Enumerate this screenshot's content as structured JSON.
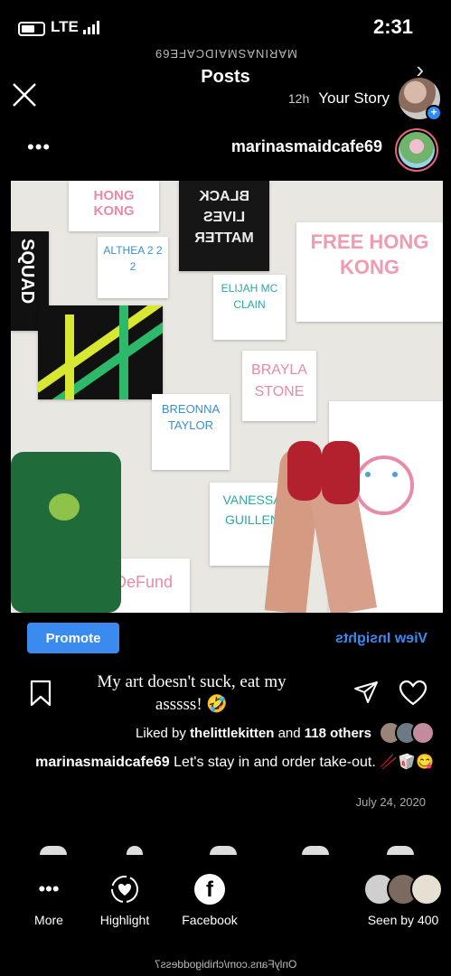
{
  "status": {
    "network": "LTE",
    "time": "2:31"
  },
  "header": {
    "account_overlay": "MARINASMAIDCAFE69",
    "title": "Posts"
  },
  "story": {
    "label": "Your Story",
    "time": "12h"
  },
  "post": {
    "username": "marinasmaidcafe69",
    "promote_label": "Promote",
    "insights_label": "View Insights",
    "caption_overlay": "My art doesn't suck, eat my asssss! 🤣",
    "liked_by_prefix": "Liked by",
    "liked_by_user": "thelittlekitten",
    "liked_by_and": "and",
    "liked_by_others": "118 others",
    "caption_user": "marinasmaidcafe69",
    "caption_text": "Let's stay in and order take-out. 🥢🥡😋",
    "date": "July 24, 2020"
  },
  "artwork": {
    "hong_kong_small": "HONG KONG",
    "blm": "BLACK LIVES MATTER",
    "squad": "SQUAD",
    "althea": "ALTHEA 2 2 2",
    "elijah": "ELIJAH MC CLAIN",
    "free_hk": "FREE HONG KONG",
    "breonna": "BREONNA TAYLOR",
    "brayla": "BRAYLA STONE",
    "vanessa": "VANESSA GUILLEN",
    "defund": "DeFund"
  },
  "sheet": {
    "seen_label": "Seen by 400",
    "facebook_label": "Facebook",
    "highlight_label": "Highlight",
    "more_label": "More"
  },
  "watermark": "OnlyFans.com/chibigoddess7",
  "colors": {
    "accent": "#3b8af0",
    "background": "#000000",
    "story_ring": "#e2667a"
  }
}
